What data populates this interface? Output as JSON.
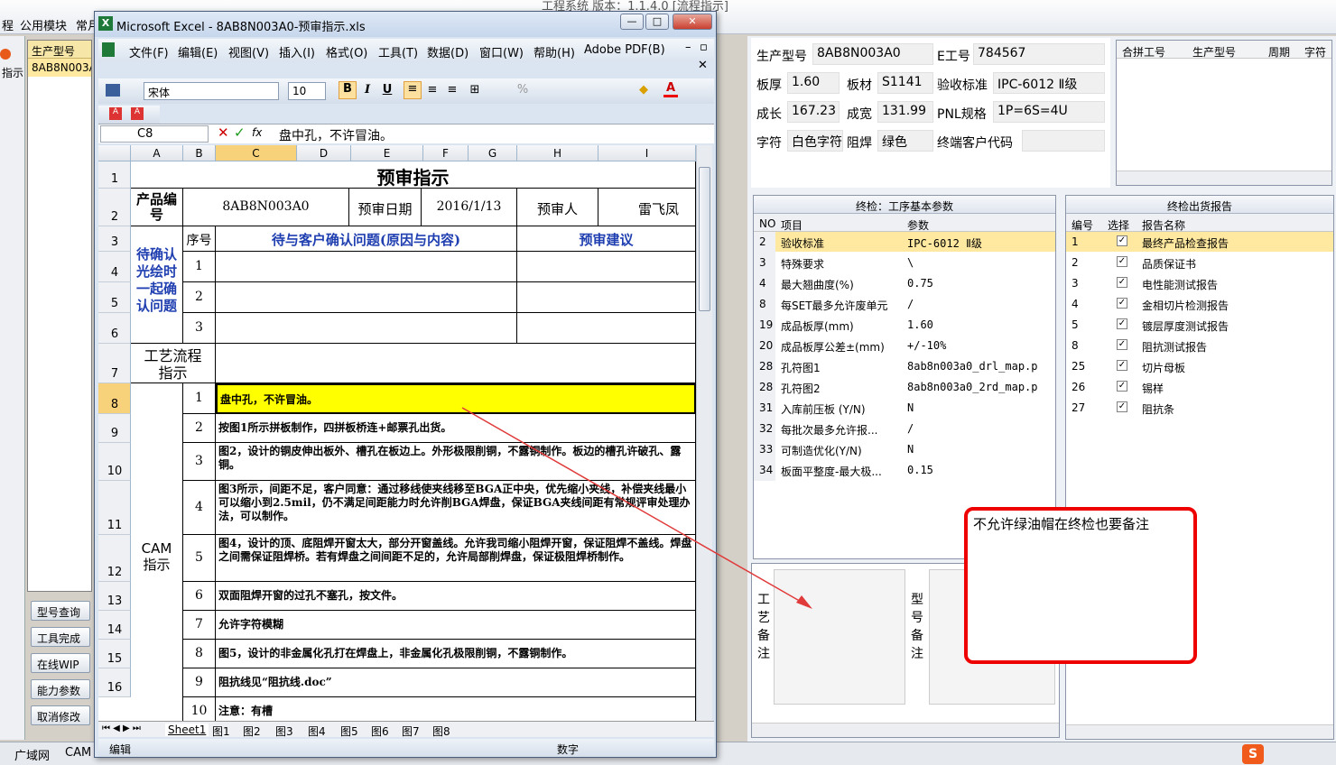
{
  "back_app": {
    "menu": [
      "程",
      "公用模块",
      "常月"
    ],
    "title_fragment": "工程系统  版本：1.1.4.0  [流程指示]",
    "left_list_header": "生产型号",
    "left_list_row": "8AB8N003A0",
    "left_col_label": "指示",
    "buttons": [
      "型号查询",
      "工具完成",
      "在线WIP",
      "能力参数",
      "取消修改"
    ],
    "statusbar": {
      "item1": "广域网",
      "item2": "CAM"
    }
  },
  "right_app": {
    "info": {
      "product_model_label": "生产型号",
      "product_model": "8AB8N003A0",
      "e_no_label": "E工号",
      "e_no": "784567",
      "thickness_label": "板厚",
      "thickness": "1.60",
      "material_label": "板材",
      "material": "S1141",
      "accept_std_label": "验收标准",
      "accept_std": "IPC-6012 Ⅱ级",
      "length_label": "成长",
      "length": "167.23",
      "width_label": "成宽",
      "width": "131.99",
      "pnl_label": "PNL规格",
      "pnl": "1P=6S=4U",
      "char_label": "字符",
      "char": "白色字符",
      "mask_label": "阻焊",
      "mask": "绿色",
      "customer_code_label": "终端客户代码",
      "customer_code": ""
    },
    "merge_grid": {
      "headers": [
        "合拼工号",
        "生产型号",
        "周期",
        "字符"
      ]
    },
    "params": {
      "title": "终检：工序基本参数",
      "headers": [
        "NO",
        "项目",
        "参数"
      ],
      "rows": [
        {
          "no": "2",
          "item": "验收标准",
          "value": "IPC-6012 Ⅱ级"
        },
        {
          "no": "3",
          "item": "特殊要求",
          "value": "\\"
        },
        {
          "no": "4",
          "item": "最大翘曲度(%)",
          "value": "0.75"
        },
        {
          "no": "8",
          "item": "每SET最多允许废单元",
          "value": "/"
        },
        {
          "no": "19",
          "item": "成品板厚(mm)",
          "value": "1.60"
        },
        {
          "no": "20",
          "item": "成品板厚公差±(mm)",
          "value": "+/-10%"
        },
        {
          "no": "28",
          "item": "孔符图1",
          "value": "8ab8n003a0_drl_map.p"
        },
        {
          "no": "28",
          "item": "孔符图2",
          "value": "8ab8n003a0_2rd_map.p"
        },
        {
          "no": "31",
          "item": "入库前压板 (Y/N)",
          "value": "N"
        },
        {
          "no": "32",
          "item": "每批次最多允许报...",
          "value": "/"
        },
        {
          "no": "33",
          "item": "可制造优化(Y/N)",
          "value": "N"
        },
        {
          "no": "34",
          "item": "板面平整度-最大极...",
          "value": "0.15"
        }
      ]
    },
    "reports": {
      "title": "终检出货报告",
      "headers": [
        "编号",
        "选择",
        "报告名称"
      ],
      "rows": [
        {
          "no": "1",
          "name": "最终产品检查报告"
        },
        {
          "no": "2",
          "name": "品质保证书"
        },
        {
          "no": "3",
          "name": "电性能测试报告"
        },
        {
          "no": "4",
          "name": "金相切片检测报告"
        },
        {
          "no": "5",
          "name": "镀层厚度测试报告"
        },
        {
          "no": "8",
          "name": "阻抗测试报告"
        },
        {
          "no": "25",
          "name": "切片母板"
        },
        {
          "no": "26",
          "name": "锡样"
        },
        {
          "no": "27",
          "name": "阻抗条"
        }
      ],
      "check_mark": "✓"
    },
    "notes": {
      "process_label": "工艺备注",
      "model_label": "型号备注"
    }
  },
  "callout": {
    "text": "不允许绿油帽在终检也要备注"
  },
  "excel": {
    "title": "Microsoft Excel - 8AB8N003A0-预审指示.xls",
    "menu": [
      "文件(F)",
      "编辑(E)",
      "视图(V)",
      "插入(I)",
      "格式(O)",
      "工具(T)",
      "数据(D)",
      "窗口(W)",
      "帮助(H)",
      "Adobe PDF(B)"
    ],
    "font": "宋体",
    "font_size": "10",
    "name_box": "C8",
    "formula": "盘中孔，不许冒油。",
    "columns": [
      "A",
      "B",
      "C",
      "D",
      "E",
      "F",
      "G",
      "H",
      "I"
    ],
    "sheet": {
      "title": "预审指示",
      "product_no_label": "产品编号",
      "product_no": "8AB8N003A0",
      "review_date_label": "预审日期",
      "review_date": "2016/1/13",
      "reviewer_label": "预审人",
      "reviewer": "雷飞凤",
      "seq_label": "序号",
      "confirm_header": "待与客户确认问题(原因与内容)",
      "suggest_header": "预审建议",
      "confirm_block": "待确认光绘时一起确认问题",
      "process_label": "工艺流程指示",
      "cam_label": "CAM指示",
      "items": [
        {
          "no": "1",
          "text": "盘中孔，不许冒油。"
        },
        {
          "no": "2",
          "text": "按图1所示拼板制作，四拼板桥连+邮票孔出货。"
        },
        {
          "no": "3",
          "text": "图2，设计的铜皮伸出板外、槽孔在板边上。外形极限削铜，不露铜制作。板边的槽孔许破孔、露铜。"
        },
        {
          "no": "4",
          "text": "图3所示，间距不足，客户同意：通过移线使夹线移至BGA正中央，优先缩小夹线，补偿夹线最小可以缩小到2.5mil，仍不满足间距能力时允许削BGA焊盘，保证BGA夹线间距有常规评审处理办法，可以制作。"
        },
        {
          "no": "5",
          "text": "图4，设计的顶、底阻焊开窗太大，部分开窗盖线。允许我司缩小阻焊开窗，保证阻焊不盖线。焊盘之间需保证阻焊桥。若有焊盘之间间距不足的，允许局部削焊盘，保证极阻焊桥制作。"
        },
        {
          "no": "6",
          "text": "双面阻焊开窗的过孔不塞孔，按文件。"
        },
        {
          "no": "7",
          "text": "允许字符模糊"
        },
        {
          "no": "8",
          "text": "图5，设计的非金属化孔打在焊盘上，非金属化孔极限削铜，不露铜制作。"
        },
        {
          "no": "9",
          "text": "阻抗线见“阻抗线.doc”"
        },
        {
          "no": "10",
          "text": "注意：有槽"
        }
      ],
      "row_numbers": [
        "1",
        "2",
        "3",
        "4",
        "5",
        "6",
        "7",
        "8",
        "9",
        "10",
        "11",
        "12",
        "13",
        "14",
        "15",
        "16"
      ]
    },
    "tabs": [
      "Sheet1",
      "图1",
      "图2",
      "图3",
      "图4",
      "图5",
      "图6",
      "图7",
      "图8"
    ],
    "status_left": "编辑",
    "status_right": "数字"
  }
}
